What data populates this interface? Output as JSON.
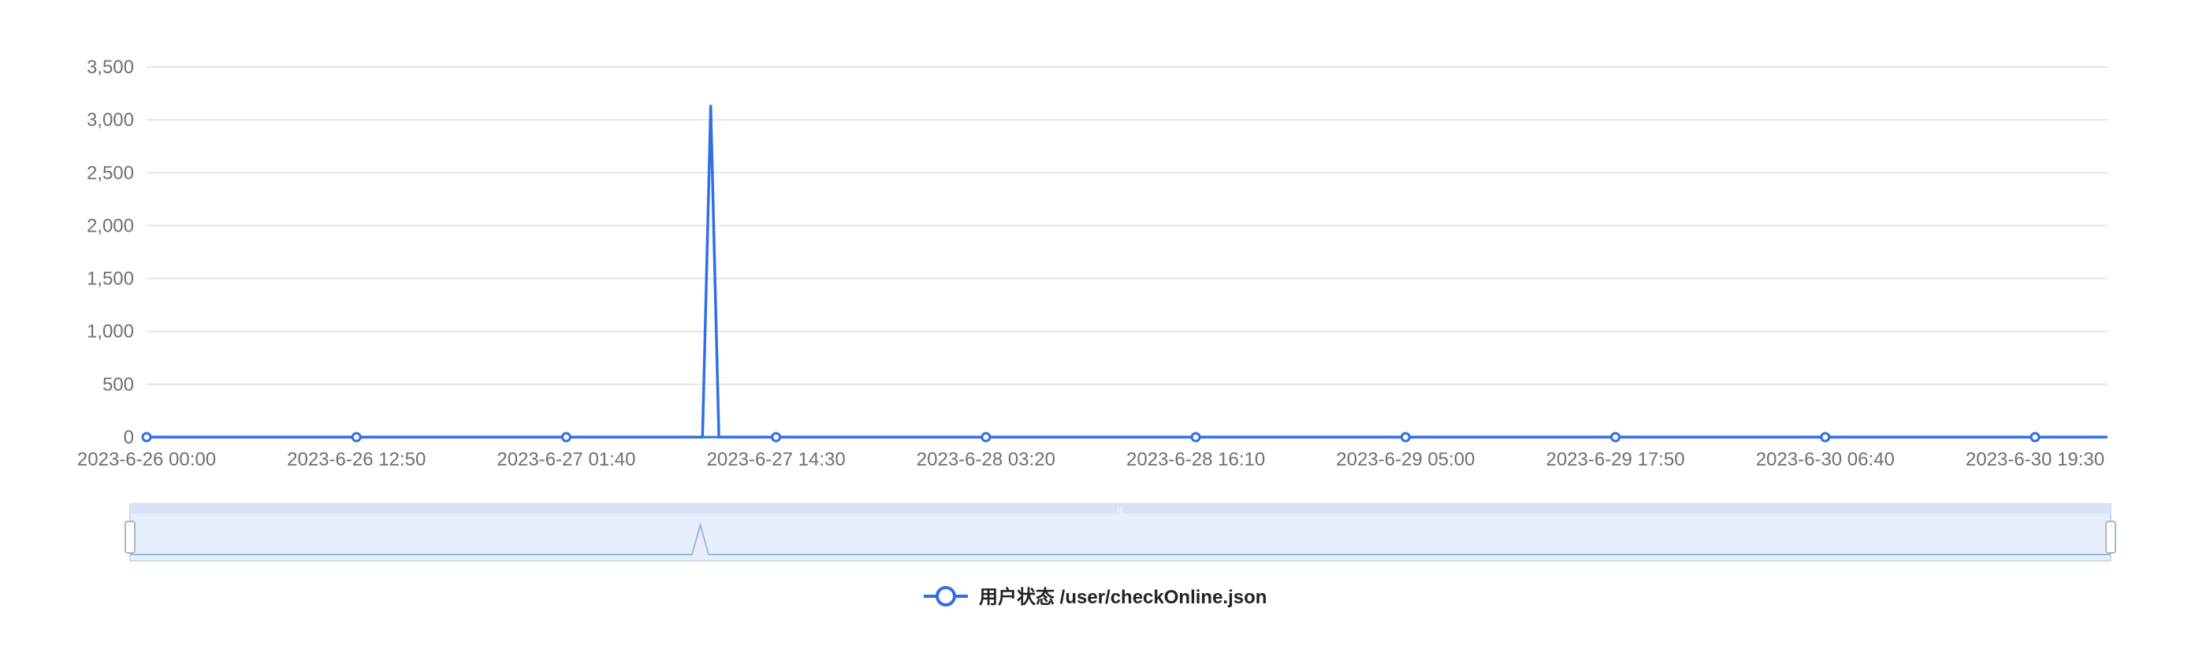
{
  "chart_data": {
    "type": "line",
    "title": "",
    "xlabel": "",
    "ylabel": "",
    "ylim": [
      0,
      3500
    ],
    "y_ticks": [
      0,
      500,
      1000,
      1500,
      2000,
      2500,
      3000,
      3500
    ],
    "y_tick_labels": [
      "0",
      "500",
      "1,000",
      "1,500",
      "2,000",
      "2,500",
      "3,000",
      "3,500"
    ],
    "x_tick_labels": [
      "2023-6-26 00:00",
      "2023-6-26 12:50",
      "2023-6-27 01:40",
      "2023-6-27 14:30",
      "2023-6-28 03:20",
      "2023-6-28 16:10",
      "2023-6-29 05:00",
      "2023-6-29 17:50",
      "2023-6-30 06:40",
      "2023-6-30 19:30"
    ],
    "grid": true,
    "legend_position": "bottom-center",
    "series": [
      {
        "name": "用户状态 /user/checkOnline.json",
        "color": "#2f6fe4",
        "points": [
          {
            "x": "2023-6-26 00:00",
            "y": 0
          },
          {
            "x": "2023-6-26 12:50",
            "y": 0
          },
          {
            "x": "2023-6-27 01:40",
            "y": 0
          },
          {
            "x": "2023-6-27 10:00",
            "y": 0
          },
          {
            "x": "2023-6-27 10:30",
            "y": 3130
          },
          {
            "x": "2023-6-27 11:00",
            "y": 0
          },
          {
            "x": "2023-6-27 14:30",
            "y": 0
          },
          {
            "x": "2023-6-28 03:20",
            "y": 0
          },
          {
            "x": "2023-6-28 16:10",
            "y": 0
          },
          {
            "x": "2023-6-29 05:00",
            "y": 0
          },
          {
            "x": "2023-6-29 17:50",
            "y": 0
          },
          {
            "x": "2023-6-30 06:40",
            "y": 0
          },
          {
            "x": "2023-6-30 19:30",
            "y": 0
          },
          {
            "x": "2023-6-30 23:50",
            "y": 0
          }
        ]
      }
    ],
    "data_zoom": {
      "start": 0,
      "end": 100,
      "handle_label": "III"
    }
  }
}
